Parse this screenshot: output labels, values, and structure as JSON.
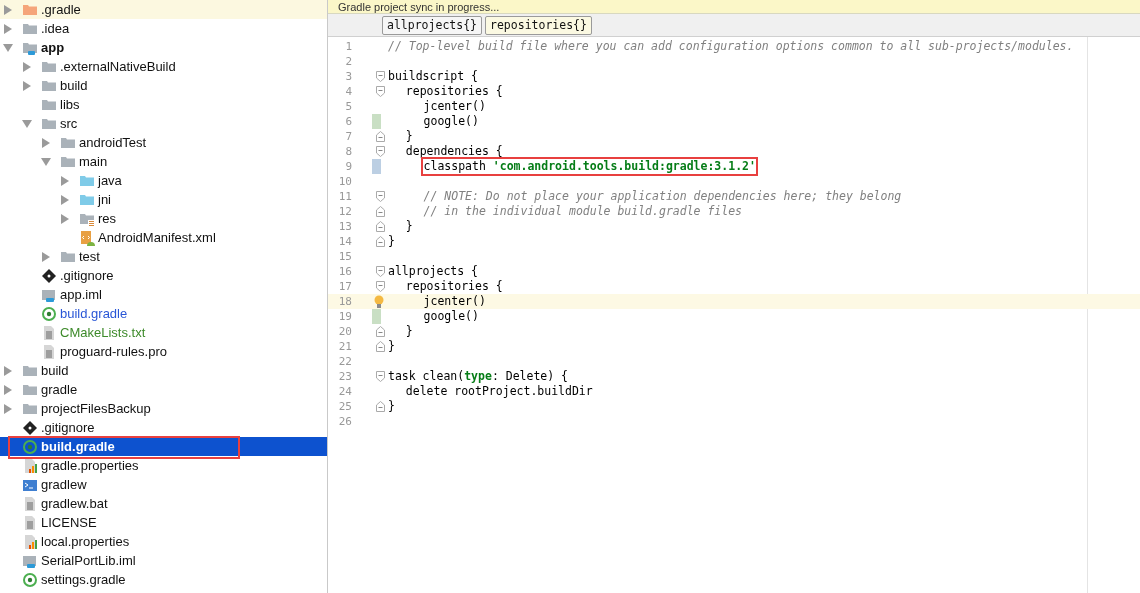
{
  "banner": {
    "text": "Gradle project sync in progress..."
  },
  "breadcrumbs": [
    {
      "label": "allprojects{}",
      "selected": false
    },
    {
      "label": "repositories{}",
      "selected": true
    }
  ],
  "project_tree": [
    {
      "name": ".gradle",
      "kind": "folder-excluded",
      "expanded": false,
      "modified": false,
      "added": false,
      "selected": false,
      "highlighted": true,
      "outlined": false
    },
    {
      "name": ".idea",
      "kind": "folder",
      "expanded": false,
      "modified": false,
      "added": false,
      "selected": false,
      "highlighted": false,
      "outlined": false
    },
    {
      "name": "app",
      "kind": "module",
      "expanded": true,
      "modified": false,
      "added": false,
      "selected": false,
      "highlighted": false,
      "outlined": false,
      "children": [
        {
          "name": ".externalNativeBuild",
          "kind": "folder",
          "expanded": false,
          "modified": false,
          "added": false,
          "selected": false,
          "highlighted": false,
          "outlined": false
        },
        {
          "name": "build",
          "kind": "folder",
          "expanded": false,
          "modified": false,
          "added": false,
          "selected": false,
          "highlighted": false,
          "outlined": false
        },
        {
          "name": "libs",
          "kind": "folder",
          "modified": false,
          "added": false,
          "selected": false,
          "highlighted": false,
          "outlined": false
        },
        {
          "name": "src",
          "kind": "folder",
          "expanded": true,
          "modified": false,
          "added": false,
          "selected": false,
          "highlighted": false,
          "outlined": false,
          "children": [
            {
              "name": "androidTest",
              "kind": "folder",
              "expanded": false,
              "modified": false,
              "added": false,
              "selected": false,
              "highlighted": false,
              "outlined": false
            },
            {
              "name": "main",
              "kind": "folder",
              "expanded": true,
              "modified": false,
              "added": false,
              "selected": false,
              "highlighted": false,
              "outlined": false,
              "children": [
                {
                  "name": "java",
                  "kind": "folder-source",
                  "expanded": false,
                  "modified": false,
                  "added": false,
                  "selected": false,
                  "highlighted": false,
                  "outlined": false
                },
                {
                  "name": "jni",
                  "kind": "folder-source",
                  "expanded": false,
                  "modified": false,
                  "added": false,
                  "selected": false,
                  "highlighted": false,
                  "outlined": false
                },
                {
                  "name": "res",
                  "kind": "folder-resources",
                  "expanded": false,
                  "modified": false,
                  "added": false,
                  "selected": false,
                  "highlighted": false,
                  "outlined": false
                },
                {
                  "name": "AndroidManifest.xml",
                  "kind": "manifest",
                  "modified": false,
                  "added": false,
                  "selected": false,
                  "highlighted": false,
                  "outlined": false
                }
              ]
            },
            {
              "name": "test",
              "kind": "folder",
              "expanded": false,
              "modified": false,
              "added": false,
              "selected": false,
              "highlighted": false,
              "outlined": false
            }
          ]
        },
        {
          "name": ".gitignore",
          "kind": "git",
          "modified": false,
          "added": false,
          "selected": false,
          "highlighted": false,
          "outlined": false
        },
        {
          "name": "app.iml",
          "kind": "iml",
          "modified": false,
          "added": false,
          "selected": false,
          "highlighted": false,
          "outlined": false
        },
        {
          "name": "build.gradle",
          "kind": "gradle",
          "modified": true,
          "added": false,
          "selected": false,
          "highlighted": false,
          "outlined": false
        },
        {
          "name": "CMakeLists.txt",
          "kind": "text",
          "modified": false,
          "added": true,
          "selected": false,
          "highlighted": false,
          "outlined": false
        },
        {
          "name": "proguard-rules.pro",
          "kind": "text",
          "modified": false,
          "added": false,
          "selected": false,
          "highlighted": false,
          "outlined": false
        }
      ]
    },
    {
      "name": "build",
      "kind": "folder",
      "expanded": false,
      "modified": false,
      "added": false,
      "selected": false,
      "highlighted": false,
      "outlined": false
    },
    {
      "name": "gradle",
      "kind": "folder",
      "expanded": false,
      "modified": false,
      "added": false,
      "selected": false,
      "highlighted": false,
      "outlined": false
    },
    {
      "name": "projectFilesBackup",
      "kind": "folder",
      "expanded": false,
      "modified": false,
      "added": false,
      "selected": false,
      "highlighted": false,
      "outlined": false
    },
    {
      "name": ".gitignore",
      "kind": "git",
      "modified": false,
      "added": false,
      "selected": false,
      "highlighted": false,
      "outlined": false
    },
    {
      "name": "build.gradle",
      "kind": "gradle",
      "modified": false,
      "added": false,
      "selected": true,
      "highlighted": false,
      "outlined": true
    },
    {
      "name": "gradle.properties",
      "kind": "properties",
      "modified": false,
      "added": false,
      "selected": false,
      "highlighted": false,
      "outlined": false
    },
    {
      "name": "gradlew",
      "kind": "shell",
      "modified": false,
      "added": false,
      "selected": false,
      "highlighted": false,
      "outlined": false
    },
    {
      "name": "gradlew.bat",
      "kind": "text",
      "modified": false,
      "added": false,
      "selected": false,
      "highlighted": false,
      "outlined": false
    },
    {
      "name": "LICENSE",
      "kind": "text",
      "modified": false,
      "added": false,
      "selected": false,
      "highlighted": false,
      "outlined": false
    },
    {
      "name": "local.properties",
      "kind": "properties",
      "modified": false,
      "added": false,
      "selected": false,
      "highlighted": false,
      "outlined": false
    },
    {
      "name": "SerialPortLib.iml",
      "kind": "iml",
      "modified": false,
      "added": false,
      "selected": false,
      "highlighted": false,
      "outlined": false
    },
    {
      "name": "settings.gradle",
      "kind": "gradle",
      "modified": false,
      "added": false,
      "selected": false,
      "highlighted": false,
      "outlined": false
    }
  ],
  "editor_lines": [
    {
      "number": "1",
      "kind": "plain",
      "added": false,
      "modified": false,
      "current": false,
      "bulb": false,
      "outlined": false,
      "tokens": [
        {
          "kind": "comment",
          "text": "// Top-level build file where you can add configuration options common to all sub-projects/modules."
        }
      ]
    },
    {
      "number": "2",
      "kind": "plain",
      "added": false,
      "modified": false,
      "current": false,
      "bulb": false,
      "outlined": false
    },
    {
      "number": "3",
      "kind": "fold-start",
      "added": false,
      "modified": false,
      "current": false,
      "bulb": false,
      "outlined": false,
      "tokens": [
        {
          "kind": "plain",
          "text": "buildscript {"
        }
      ]
    },
    {
      "number": "4",
      "kind": "fold-start",
      "added": false,
      "modified": false,
      "current": false,
      "bulb": false,
      "outlined": false,
      "tokens": [
        {
          "kind": "plain",
          "text": "    repositories {"
        }
      ]
    },
    {
      "number": "5",
      "kind": "plain",
      "added": false,
      "modified": false,
      "current": false,
      "bulb": false,
      "outlined": false,
      "tokens": [
        {
          "kind": "plain",
          "text": "        jcenter()"
        }
      ]
    },
    {
      "number": "6",
      "kind": "plain",
      "added": true,
      "modified": false,
      "current": false,
      "bulb": false,
      "outlined": false,
      "tokens": [
        {
          "kind": "plain",
          "text": "        google()"
        }
      ]
    },
    {
      "number": "7",
      "kind": "fold-end",
      "added": false,
      "modified": false,
      "current": false,
      "bulb": false,
      "outlined": false,
      "tokens": [
        {
          "kind": "plain",
          "text": "    }"
        }
      ]
    },
    {
      "number": "8",
      "kind": "fold-start",
      "added": false,
      "modified": false,
      "current": false,
      "bulb": false,
      "outlined": false,
      "tokens": [
        {
          "kind": "plain",
          "text": "    dependencies {"
        }
      ]
    },
    {
      "number": "9",
      "kind": "plain",
      "added": false,
      "modified": true,
      "current": false,
      "bulb": false,
      "outlined": true,
      "tokens": [
        {
          "kind": "plain",
          "text": "        classpath "
        },
        {
          "kind": "string",
          "text": "'com.android.tools.build:gradle:3.1.2'"
        }
      ]
    },
    {
      "number": "10",
      "kind": "plain",
      "added": false,
      "modified": false,
      "current": false,
      "bulb": false,
      "outlined": false
    },
    {
      "number": "11",
      "kind": "fold-start",
      "added": false,
      "modified": false,
      "current": false,
      "bulb": false,
      "outlined": false,
      "tokens": [
        {
          "kind": "comment",
          "text": "        // NOTE: Do not place your application dependencies here; they belong"
        }
      ]
    },
    {
      "number": "12",
      "kind": "fold-end",
      "added": false,
      "modified": false,
      "current": false,
      "bulb": false,
      "outlined": false,
      "tokens": [
        {
          "kind": "comment",
          "text": "        // in the individual module build.gradle files"
        }
      ]
    },
    {
      "number": "13",
      "kind": "fold-end",
      "added": false,
      "modified": false,
      "current": false,
      "bulb": false,
      "outlined": false,
      "tokens": [
        {
          "kind": "plain",
          "text": "    }"
        }
      ]
    },
    {
      "number": "14",
      "kind": "fold-end",
      "added": false,
      "modified": false,
      "current": false,
      "bulb": false,
      "outlined": false,
      "tokens": [
        {
          "kind": "plain",
          "text": "}"
        }
      ]
    },
    {
      "number": "15",
      "kind": "plain",
      "added": false,
      "modified": false,
      "current": false,
      "bulb": false,
      "outlined": false
    },
    {
      "number": "16",
      "kind": "fold-start",
      "added": false,
      "modified": false,
      "current": false,
      "bulb": false,
      "outlined": false,
      "tokens": [
        {
          "kind": "plain",
          "text": "allprojects {"
        }
      ]
    },
    {
      "number": "17",
      "kind": "fold-start",
      "added": false,
      "modified": false,
      "current": false,
      "bulb": false,
      "outlined": false,
      "tokens": [
        {
          "kind": "plain",
          "text": "    repositories {"
        }
      ]
    },
    {
      "number": "18",
      "kind": "plain",
      "added": false,
      "modified": false,
      "current": true,
      "bulb": true,
      "outlined": false,
      "tokens": [
        {
          "kind": "plain",
          "text": "        jcenter()"
        }
      ]
    },
    {
      "number": "19",
      "kind": "plain",
      "added": true,
      "modified": false,
      "current": false,
      "bulb": false,
      "outlined": false,
      "tokens": [
        {
          "kind": "plain",
          "text": "        google()"
        }
      ]
    },
    {
      "number": "20",
      "kind": "fold-end",
      "added": false,
      "modified": false,
      "current": false,
      "bulb": false,
      "outlined": false,
      "tokens": [
        {
          "kind": "plain",
          "text": "    }"
        }
      ]
    },
    {
      "number": "21",
      "kind": "fold-end",
      "added": false,
      "modified": false,
      "current": false,
      "bulb": false,
      "outlined": false,
      "tokens": [
        {
          "kind": "plain",
          "text": "}"
        }
      ]
    },
    {
      "number": "22",
      "kind": "plain",
      "added": false,
      "modified": false,
      "current": false,
      "bulb": false,
      "outlined": false
    },
    {
      "number": "23",
      "kind": "fold-start",
      "added": false,
      "modified": false,
      "current": false,
      "bulb": false,
      "outlined": false,
      "tokens": [
        {
          "kind": "plain",
          "text": "task clean("
        },
        {
          "kind": "named-arg",
          "text": "type"
        },
        {
          "kind": "plain",
          "text": ": Delete) {"
        }
      ]
    },
    {
      "number": "24",
      "kind": "plain",
      "added": false,
      "modified": false,
      "current": false,
      "bulb": false,
      "outlined": false,
      "tokens": [
        {
          "kind": "plain",
          "text": "    delete rootProject.buildDir"
        }
      ]
    },
    {
      "number": "25",
      "kind": "fold-end",
      "added": false,
      "modified": false,
      "current": false,
      "bulb": false,
      "outlined": false,
      "tokens": [
        {
          "kind": "plain",
          "text": "}"
        }
      ]
    },
    {
      "number": "26",
      "kind": "plain",
      "added": false,
      "modified": false,
      "current": false,
      "bulb": false,
      "outlined": false
    }
  ]
}
